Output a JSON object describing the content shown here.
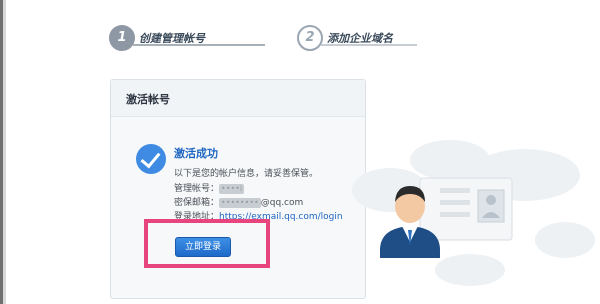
{
  "steps": [
    {
      "number": "1",
      "label": "创建管理帐号"
    },
    {
      "number": "2",
      "label": "添加企业域名"
    }
  ],
  "card": {
    "title": "激活帐号",
    "success_title": "激活成功",
    "notice": "以下是您的帐户信息，请妥善保管。",
    "account_label": "管理帐号：",
    "account_value": "••••i",
    "email_label": "密保邮箱：",
    "email_value_masked": "••••••••",
    "email_suffix": "@qq.com",
    "login_url_label": "登录地址：",
    "login_url": "https://exmail.qq.com/login",
    "login_button": "立即登录"
  },
  "colors": {
    "accent": "#1f66c2",
    "highlight": "#e8447d",
    "check": "#3f8be4"
  }
}
